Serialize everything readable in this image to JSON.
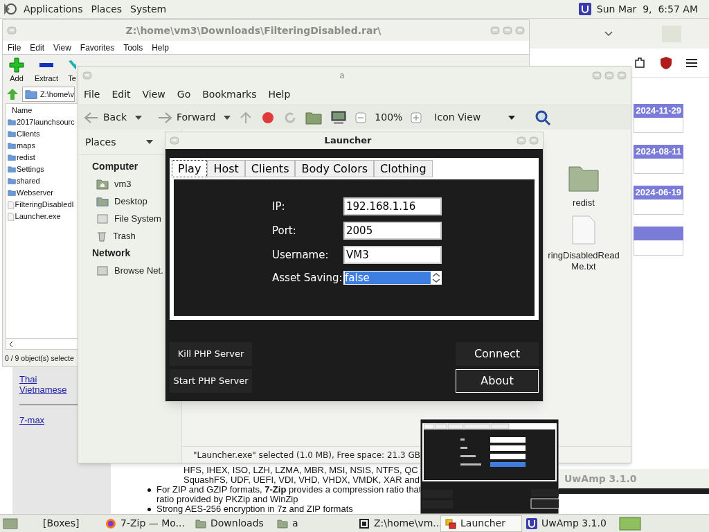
{
  "top_panel": {
    "menus": [
      "Applications",
      "Places",
      "System"
    ],
    "clock": "Sun Mar  9,  6:57 AM"
  },
  "browser": {
    "sidebar_links": [
      "Thai",
      "Vietnamese",
      "7-max"
    ],
    "date_badges": [
      "2024-11-29",
      "2024-08-11",
      "2024-06-19"
    ],
    "content_lines": [
      {
        "kind": "nested",
        "text": "HFS, IHEX, ISO, LZH, LZMA, MBR, MSI, NSIS, NTFS, QC"
      },
      {
        "kind": "nested",
        "text": "SquashFS, UDF, UEFI, VDI, VHD, VHDX, VMDK, XAR and"
      },
      {
        "kind": "bullet",
        "text": "For ZIP and GZIP formats, **7-Zip** provides a compression ratio that"
      },
      {
        "kind": "continuation",
        "text": "ratio provided by PKZip and WinZip"
      },
      {
        "kind": "bullet",
        "text": "Strong AES-256 encryption in 7z and ZIP formats"
      }
    ]
  },
  "background_window": {
    "title": "UwAmp 3.1.0"
  },
  "archive_window": {
    "title": "Z:\\home\\vm3\\Downloads\\FilteringDisabled.rar\\",
    "menus": [
      "File",
      "Edit",
      "View",
      "Favorites",
      "Tools",
      "Help"
    ],
    "toolbar": [
      "Add",
      "Extract",
      "Te"
    ],
    "address": "Z:\\home\\v",
    "column": "Name",
    "files": [
      {
        "name": "2017launchsourc",
        "kind": "folder"
      },
      {
        "name": "Clients",
        "kind": "folder"
      },
      {
        "name": "maps",
        "kind": "folder"
      },
      {
        "name": "redist",
        "kind": "folder"
      },
      {
        "name": "Settings",
        "kind": "folder"
      },
      {
        "name": "shared",
        "kind": "folder"
      },
      {
        "name": "Webserver",
        "kind": "folder"
      },
      {
        "name": "FilteringDisabledI",
        "kind": "file"
      },
      {
        "name": "Launcher.exe",
        "kind": "file"
      }
    ],
    "status": "0 / 9 object(s) selecte"
  },
  "file_manager": {
    "title": "a",
    "menus": [
      "File",
      "Edit",
      "View",
      "Go",
      "Bookmarks",
      "Help"
    ],
    "back": "Back",
    "forward": "Forward",
    "zoom": "100%",
    "view_mode": "Icon View",
    "places_header": "Places",
    "sections": [
      {
        "heading": "Computer",
        "items": [
          "vm3",
          "Desktop",
          "File System",
          "Trash"
        ]
      },
      {
        "heading": "Network",
        "items": [
          "Browse Net."
        ]
      }
    ],
    "icons": [
      {
        "name": "redist",
        "kind": "folder"
      },
      {
        "name": "ringDisabledRead\nMe.txt",
        "kind": "file"
      }
    ],
    "status": "\"Launcher.exe\" selected (1.0 MB), Free space: 21.3 GB"
  },
  "launcher": {
    "title": "Launcher",
    "tabs": [
      {
        "label": "Play",
        "selected": true
      },
      {
        "label": "Host",
        "selected": false
      },
      {
        "label": "Clients",
        "selected": false
      },
      {
        "label": "Body Colors",
        "selected": false
      },
      {
        "label": "Clothing",
        "selected": false
      }
    ],
    "fields": [
      {
        "label": "IP:",
        "value": "192.168.1.16",
        "kind": "text",
        "selected": false
      },
      {
        "label": "Port:",
        "value": "2005",
        "kind": "text",
        "selected": false
      },
      {
        "label": "Username:",
        "value": "VM3",
        "kind": "text",
        "selected": false
      },
      {
        "label": "Asset Saving:",
        "value": "false",
        "kind": "spinner",
        "selected": true
      }
    ],
    "left_buttons": [
      {
        "label": "Kill PHP Server",
        "focused": false
      },
      {
        "label": "Start PHP Server",
        "focused": false
      }
    ],
    "right_buttons": [
      {
        "label": "Connect",
        "focused": false
      },
      {
        "label": "About",
        "focused": true
      }
    ]
  },
  "taskbar": {
    "items": [
      {
        "label": "[Boxes]",
        "selected": false
      },
      {
        "label": "7-Zip — Mo...",
        "selected": false
      },
      {
        "label": "Downloads",
        "selected": false
      },
      {
        "label": "a",
        "selected": false
      },
      {
        "label": "Z:\\home\\vm...",
        "selected": false
      },
      {
        "label": "Launcher",
        "selected": true
      },
      {
        "label": "UwAmp 3.1.0",
        "selected": false
      }
    ]
  }
}
